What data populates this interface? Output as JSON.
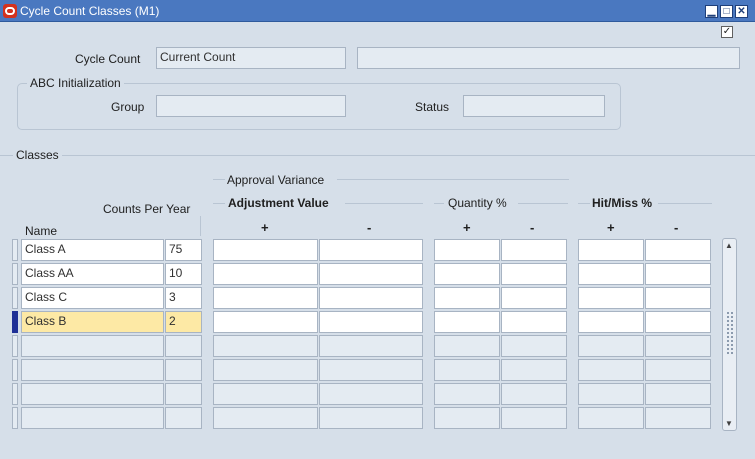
{
  "window": {
    "title": "Cycle Count Classes (M1)",
    "minimize_glyph": "▁",
    "maximize_glyph": "□",
    "close_glyph": "✕"
  },
  "header_checkbox": "✓",
  "cycle_count": {
    "label": "Cycle Count",
    "value": "Current Count",
    "description": ""
  },
  "abc_initialization": {
    "title": "ABC Initialization",
    "group_label": "Group",
    "group_value": "",
    "status_label": "Status",
    "status_value": ""
  },
  "classes": {
    "section_title": "Classes",
    "headers": {
      "name": "Name",
      "counts_per_year": "Counts Per Year",
      "approval_variance": "Approval Variance",
      "adjustment_value": "Adjustment Value",
      "quantity_pct": "Quantity %",
      "hit_miss_pct": "Hit/Miss %",
      "plus": "+",
      "minus": "-"
    },
    "rows": [
      {
        "name": "Class A",
        "counts": "75"
      },
      {
        "name": "Class AA",
        "counts": "10"
      },
      {
        "name": "Class C",
        "counts": "3"
      },
      {
        "name": "Class B",
        "counts": "2"
      },
      {
        "name": "",
        "counts": ""
      },
      {
        "name": "",
        "counts": ""
      },
      {
        "name": "",
        "counts": ""
      },
      {
        "name": "",
        "counts": ""
      }
    ],
    "selected_row": 3
  },
  "colors": {
    "titlebar": "#4a78c0",
    "background": "#d6dfe9",
    "selected_field": "#fde9a5",
    "row_indicator": "#1e2f96"
  },
  "icons": {
    "app": "oracle-icon",
    "scroll_up": "scroll-up-icon",
    "scroll_down": "scroll-down-icon"
  }
}
